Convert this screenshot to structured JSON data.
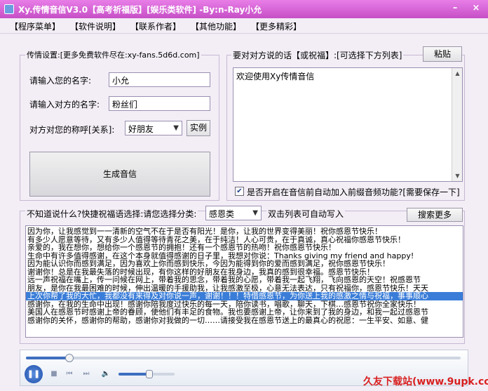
{
  "window": {
    "title": "Xy.传情音信V3.0【高考祈福版】[娱乐类软件] -By:n-Ray小允",
    "minimize": "–",
    "close": "×"
  },
  "menu": [
    "【程序菜单】",
    "【软件说明】",
    "【联系作者】",
    "【其他功能】",
    "【更多精彩】"
  ],
  "settings": {
    "group_label": "传情设置:[更多免费软件尽在:xy-fans.5d6d.com]",
    "your_name_label": "请输入您的名字:",
    "your_name_value": "小允",
    "their_name_label": "请输入对方的名字:",
    "their_name_value": "粉丝们",
    "relation_label": "对方对您的称呼[关系]:",
    "relation_value": "好朋友",
    "example_button": "实例",
    "generate_button": "生成音信"
  },
  "message": {
    "label": "要对对方说的话【或祝福】:[可选择下方列表]",
    "paste_button": "粘贴",
    "text": "欢迎使用Xy传情音信",
    "checkbox_checked": true,
    "checkbox_label": "是否开启在音信前自动加入前缀音频功能?[需要保存一下]"
  },
  "blessings": {
    "prompt_label": "不知道说什么?快捷祝福语选择:请您选择分类:",
    "category_value": "感恩类",
    "hint_label": "双击列表可自动写入",
    "search_button": "搜索更多",
    "selected_index": 9,
    "lines": [
      "因为你，让我感觉到一一清新的空气不在于是否有阳光！是你，让我的世界变得美丽！祝你感恩节快乐！",
      "有多少人愿意等待，又有多少人值得等待青花之美，在于纯洁！人心可贵，在于真诚，真心祝福你感恩节快乐！",
      "亲爱的，我在想你，想给你一个感恩节的拥抱！还有一个感恩节的热吻！祝你感恩节快乐！",
      "生命中有许多值得感谢，在这个本身就值得感谢的日子里，我想对你说：Thanks giving my friend and happy!",
      "因为能认识你而感到满足，因为喜欢上你而感到快乐，今因为能得到你的爱而感到满足，祝你感恩节快乐！",
      "谢谢你！总是在我最失落的时候出现，有你这样的好朋友在我身边，我真的感到很幸福。感恩节快乐！",
      "远一声祝福在嘴上，传一问候在网上，带着我的思念，带着我的心愿，带着我一起飞翔，飞向感恩的天空！祝感恩节",
      "朋友，是你在我最困难的时候，伸出温暖的手援助我，让我感激至极，心意无法表达，只有祝福你，感恩节快乐！天天",
      "上次你帮了我的大忙，我都没有来得及对你说一声，谢谢！！！特借感恩节，为你送上我的感激之情与祝福，事事顺心",
      "感谢你，在我的生命中出现！感谢你陪我度过快乐的每一天，陪你读书，唱歌，聊天，下棋…感恩节祝你全家快乐！",
      "美国人在感恩节时感谢上帝的眷顾，使他们有丰足的食物。我也要感谢上帝，让你来到了我的身边，和我一起过感恩节",
      "感谢你的关怀，感谢你的帮助，感谢你对我做的一切……请接受我在感恩节送上的最真心的祝愿：一生平安、如意、健"
    ]
  },
  "player": {
    "seek_fraction": 0.1,
    "volume_fraction": 0.55,
    "icons": [
      "pause-icon",
      "stop-icon",
      "prev-icon",
      "next-icon",
      "mute-icon"
    ]
  },
  "watermark": "久友下载站(www.9upk.com)",
  "colors": {
    "titlebar": "#c64fc6",
    "selection": "#3a7dd8",
    "watermark": "#d91f1f"
  }
}
